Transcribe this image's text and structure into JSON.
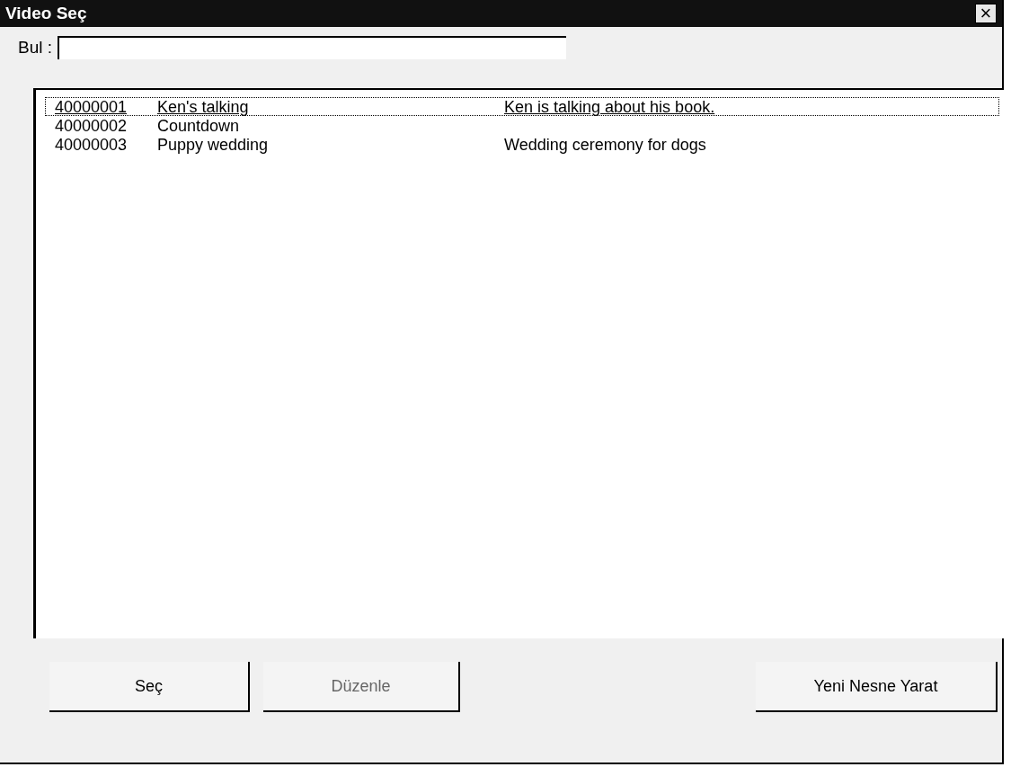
{
  "window": {
    "title": "Video Seç",
    "close": "×"
  },
  "search": {
    "label": "Bul :"
  },
  "list": {
    "rows": [
      {
        "id": "40000001",
        "name": "Ken's talking",
        "description": "Ken is talking about his book.",
        "selected": true
      },
      {
        "id": "40000002",
        "name": "Countdown",
        "selected": false
      },
      {
        "id": "40000003",
        "name": "Puppy wedding",
        "description": "Wedding ceremony for dogs",
        "selected": false
      }
    ]
  },
  "buttons": [
    {
      "label": "Seç",
      "disabled": false
    },
    {
      "label": "Düzenle",
      "disabled": true
    },
    {
      "label": "Yeni Nesne Yarat",
      "disabled": false
    }
  ]
}
